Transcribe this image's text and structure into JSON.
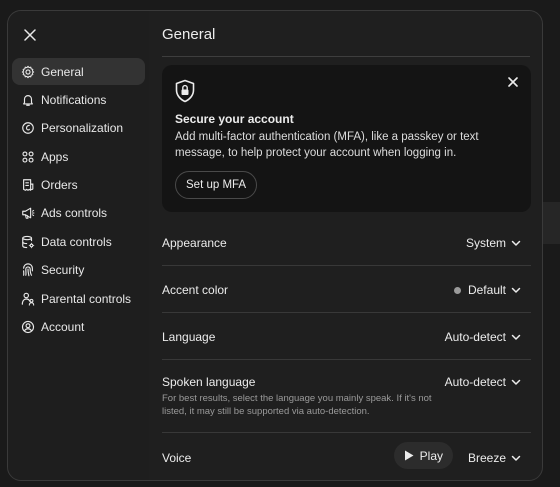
{
  "nav": {
    "items": [
      {
        "label": "General",
        "icon": "gear-icon",
        "active": true
      },
      {
        "label": "Notifications",
        "icon": "bell-icon",
        "active": false
      },
      {
        "label": "Personalization",
        "icon": "personalization-icon",
        "active": false
      },
      {
        "label": "Apps",
        "icon": "apps-grid-icon",
        "active": false
      },
      {
        "label": "Orders",
        "icon": "receipt-icon",
        "active": false
      },
      {
        "label": "Ads controls",
        "icon": "megaphone-icon",
        "active": false
      },
      {
        "label": "Data controls",
        "icon": "database-icon",
        "active": false
      },
      {
        "label": "Security",
        "icon": "fingerprint-icon",
        "active": false
      },
      {
        "label": "Parental controls",
        "icon": "parent-icon",
        "active": false
      },
      {
        "label": "Account",
        "icon": "user-circle-icon",
        "active": false
      }
    ]
  },
  "main": {
    "title": "General",
    "mfa_card": {
      "heading": "Secure your account",
      "description": "Add multi-factor authentication (MFA), like a passkey or text message, to help protect your account when logging in.",
      "button_label": "Set up MFA"
    },
    "settings": {
      "appearance": {
        "label": "Appearance",
        "value": "System"
      },
      "accent_color": {
        "label": "Accent color",
        "value": "Default",
        "swatch": "#9a9a9a"
      },
      "language": {
        "label": "Language",
        "value": "Auto-detect"
      },
      "spoken_language": {
        "label": "Spoken language",
        "value": "Auto-detect",
        "hint": "For best results, select the language you mainly speak. If it's not listed, it may still be supported via auto-detection."
      },
      "voice": {
        "label": "Voice",
        "play_label": "Play",
        "value": "Breeze"
      }
    }
  }
}
